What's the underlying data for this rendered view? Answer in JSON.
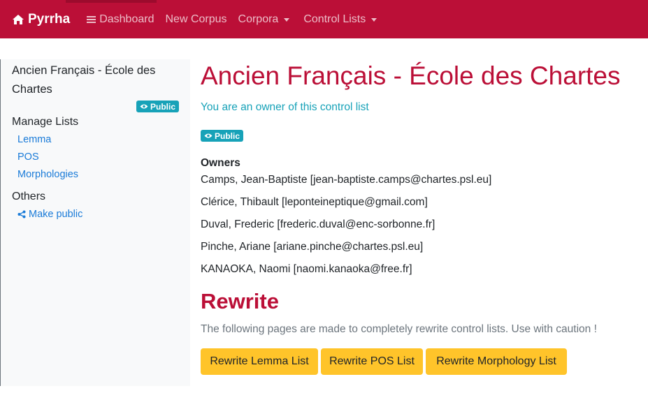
{
  "navbar": {
    "brand": "Pyrrha",
    "brand_icon": "home-icon",
    "items": [
      {
        "label": "Dashboard",
        "icon": "bars-icon"
      },
      {
        "label": "New Corpus"
      },
      {
        "label": "Corpora",
        "dropdown": true
      },
      {
        "label": "Control Lists",
        "dropdown": true
      }
    ],
    "color": "#bb0f37"
  },
  "sidebar": {
    "title": "Ancien Français - École des Chartes",
    "badge": "Public",
    "sections": [
      {
        "label": "Manage Lists",
        "links": [
          "Lemma",
          "POS",
          "Morphologies"
        ]
      },
      {
        "label": "Others",
        "links": [
          "Make public"
        ]
      }
    ]
  },
  "main": {
    "title": "Ancien Français - École des Chartes",
    "owner_note": "You are an owner of this control list",
    "badge": "Public",
    "owners_heading": "Owners",
    "owners": [
      "Camps, Jean-Baptiste [jean-baptiste.camps@chartes.psl.eu]",
      "Clérice, Thibault [leponteineptique@gmail.com]",
      "Duval, Frederic [frederic.duval@enc-sorbonne.fr]",
      "Pinche, Ariane [ariane.pinche@chartes.psl.eu]",
      "KANAOKA, Naomi [naomi.kanaoka@free.fr]"
    ],
    "rewrite_title": "Rewrite",
    "rewrite_note": "The following pages are made to completely rewrite control lists. Use with caution !",
    "buttons": [
      "Rewrite Lemma List",
      "Rewrite POS List",
      "Rewrite Morphology List"
    ]
  },
  "colors": {
    "accent": "#bb0f37",
    "info": "#17a2b8",
    "warning": "#ffc42a",
    "link": "#1a7bd8"
  }
}
